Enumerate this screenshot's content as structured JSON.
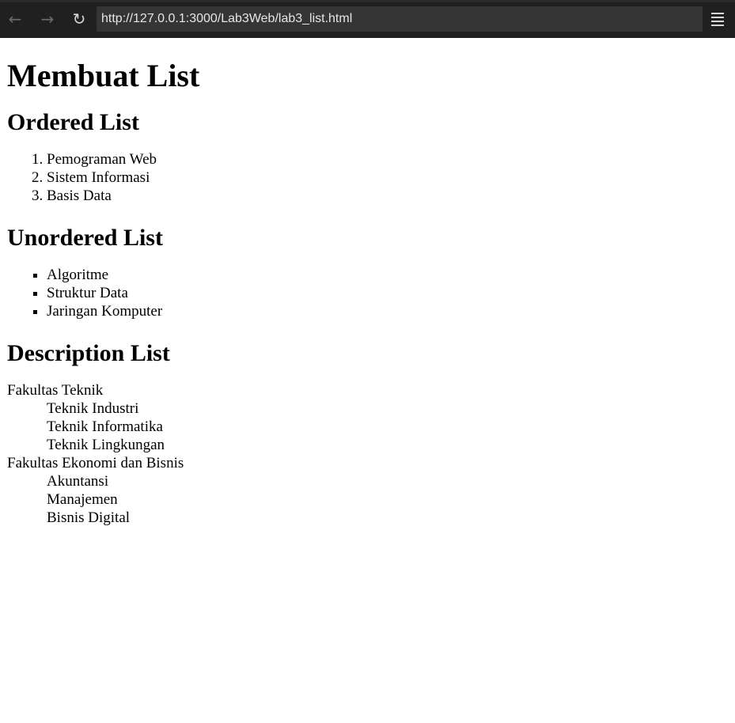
{
  "browser": {
    "url": "http://127.0.0.1:3000/Lab3Web/lab3_list.html",
    "back_icon": "←",
    "forward_icon": "→",
    "reload_icon": "↻"
  },
  "page": {
    "title": "Membuat List",
    "ordered": {
      "heading": "Ordered List",
      "items": [
        "Pemograman Web",
        "Sistem Informasi",
        "Basis Data"
      ]
    },
    "unordered": {
      "heading": "Unordered List",
      "items": [
        "Algoritme",
        "Struktur Data",
        "Jaringan Komputer"
      ]
    },
    "description": {
      "heading": "Description List",
      "groups": [
        {
          "term": "Fakultas Teknik",
          "defs": [
            "Teknik Industri",
            "Teknik Informatika",
            "Teknik Lingkungan"
          ]
        },
        {
          "term": "Fakultas Ekonomi dan Bisnis",
          "defs": [
            "Akuntansi",
            "Manajemen",
            "Bisnis Digital"
          ]
        }
      ]
    }
  }
}
